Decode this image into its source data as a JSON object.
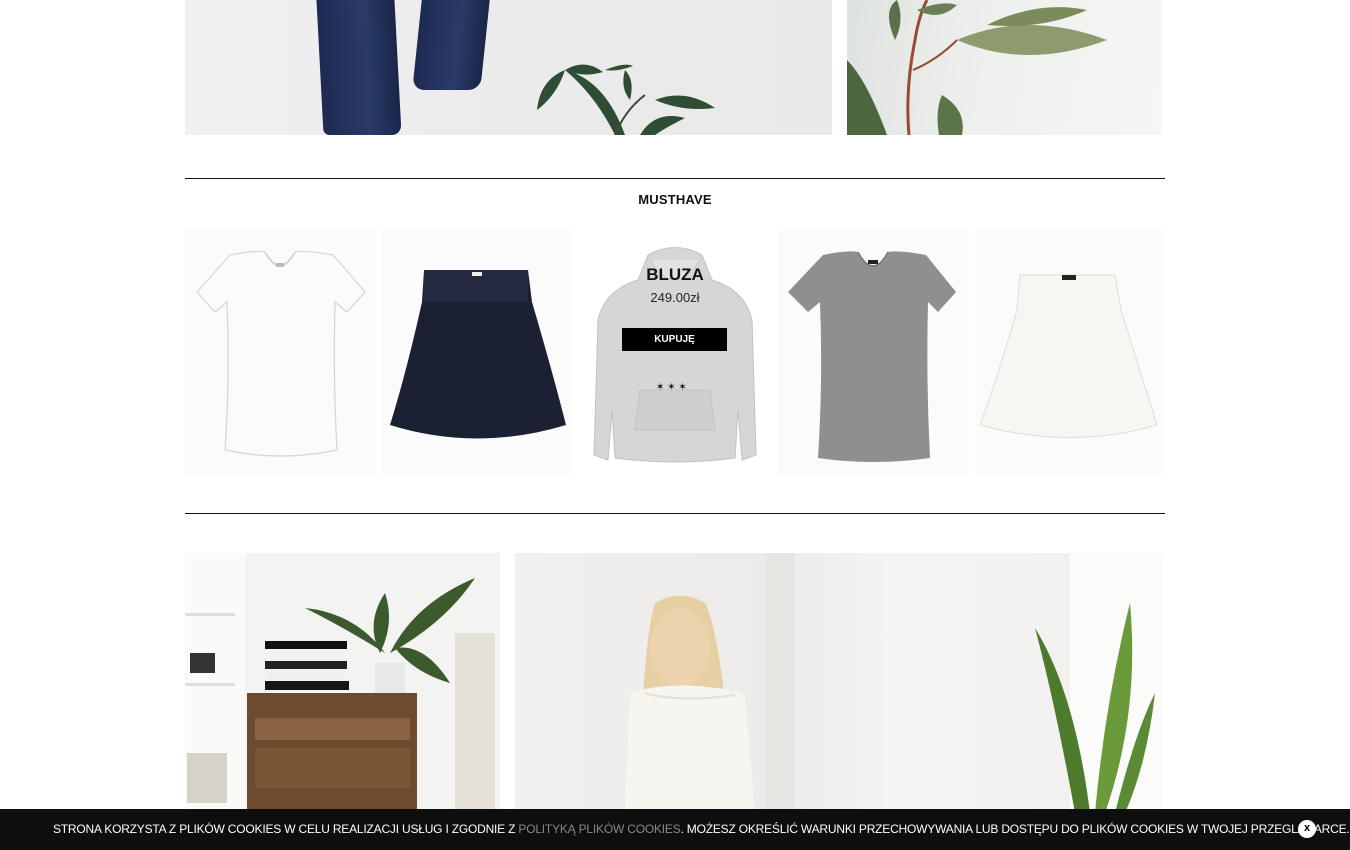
{
  "section": {
    "title": "MUSTHAVE"
  },
  "products": [
    {
      "kind": "white t-shirt"
    },
    {
      "kind": "navy skirt"
    },
    {
      "kind": "grey hoodie",
      "name": "BLUZA",
      "price": "249.00zł",
      "buy_label": "KUPUJĘ"
    },
    {
      "kind": "grey t-shirt"
    },
    {
      "kind": "white skirt"
    }
  ],
  "cookie_bar": {
    "text_before": "STRONA KORZYSTA Z PLIKÓW COOKIES W CELU REALIZACJI USŁUG I ZGODNIE Z ",
    "link_text": "POLITYKĄ PLIKÓW COOKIES",
    "text_after": ". MOŻESZ OKREŚLIĆ WARUNKI PRZECHOWYWANIA LUB DOSTĘPU DO PLIKÓW COOKIES W TWOJEJ PRZEGLĄDARCE.",
    "close_label": "x"
  },
  "colors": {
    "cookie_bar_bg": "#0e0e0e",
    "cookie_link": "#888888",
    "button_bg": "#000000",
    "navy": "#1d2a52"
  }
}
